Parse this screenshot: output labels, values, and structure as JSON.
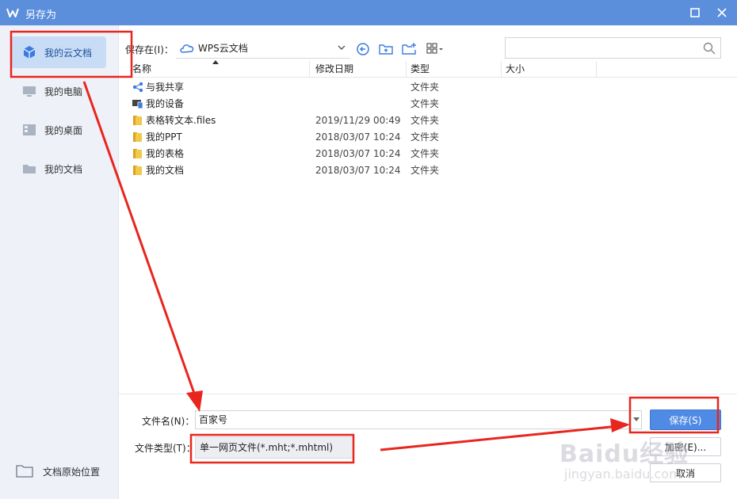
{
  "window": {
    "title": "另存为",
    "brand_color": "#5b8fdb"
  },
  "sidebar": {
    "items": [
      {
        "label": "我的云文档",
        "icon": "cloud-doc-icon",
        "active": true
      },
      {
        "label": "我的电脑",
        "icon": "computer-icon"
      },
      {
        "label": "我的桌面",
        "icon": "desktop-icon"
      },
      {
        "label": "我的文档",
        "icon": "folder-icon"
      }
    ],
    "bottom_label": "文档原始位置"
  },
  "toolbar": {
    "save_in_label": "保存在(I)：",
    "location": "WPS云文档",
    "search_placeholder": ""
  },
  "columns": [
    "名称",
    "修改日期",
    "类型",
    "大小"
  ],
  "files": [
    {
      "name": "与我共享",
      "date": "",
      "type": "文件夹",
      "icon": "share-icon"
    },
    {
      "name": "我的设备",
      "date": "",
      "type": "文件夹",
      "icon": "device-icon"
    },
    {
      "name": "表格转文本.files",
      "date": "2019/11/29 00:49",
      "type": "文件夹",
      "icon": "folder-icon"
    },
    {
      "name": "我的PPT",
      "date": "2018/03/07 10:24",
      "type": "文件夹",
      "icon": "folder-icon"
    },
    {
      "name": "我的表格",
      "date": "2018/03/07 10:24",
      "type": "文件夹",
      "icon": "folder-icon"
    },
    {
      "name": "我的文档",
      "date": "2018/03/07 10:24",
      "type": "文件夹",
      "icon": "folder-icon"
    }
  ],
  "footer": {
    "filename_label": "文件名(N)：",
    "filename_value": "百家号",
    "filetype_label": "文件类型(T)：",
    "filetype_value": "单一网页文件(*.mht;*.mhtml)",
    "save_label": "保存(S)",
    "encrypt_label": "加密(E)...",
    "cancel_label": "取消"
  },
  "watermark": {
    "logo_text": "Baidu经验",
    "url_text": "jingyan.baidu.com"
  },
  "annotation_color": "#e8261e"
}
